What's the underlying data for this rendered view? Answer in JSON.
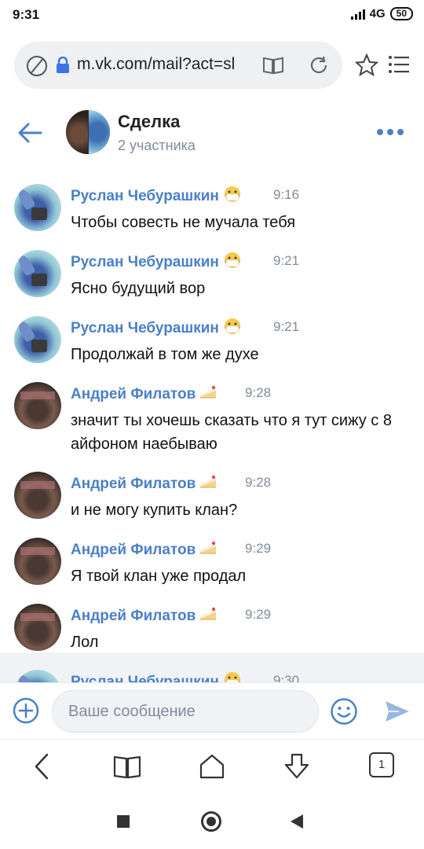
{
  "status_bar": {
    "time": "9:31",
    "network": "4G",
    "battery": "50"
  },
  "browser": {
    "url": "m.vk.com/mail?act=sl",
    "tab_count": "1"
  },
  "chat": {
    "title": "Сделка",
    "subtitle": "2 участника"
  },
  "messages": [
    {
      "author": "Руслан Чебурашкин",
      "emoji": "mask-emoji",
      "time": "9:16",
      "text": "Чтобы совесть не мучала тебя",
      "avatar": "stitch"
    },
    {
      "author": "Руслан Чебурашкин",
      "emoji": "mask-emoji",
      "time": "9:21",
      "text": "Ясно будущий вор",
      "avatar": "stitch"
    },
    {
      "author": "Руслан Чебурашкин",
      "emoji": "mask-emoji",
      "time": "9:21",
      "text": "Продолжай в том же духе",
      "avatar": "stitch"
    },
    {
      "author": "Андрей Филатов",
      "emoji": "cake-emoji",
      "time": "9:28",
      "text": "значит ты хочешь сказать что я тут сижу с 8 айфоном наебываю",
      "avatar": "andrey"
    },
    {
      "author": "Андрей Филатов",
      "emoji": "cake-emoji",
      "time": "9:28",
      "text": "и не могу купить клан?",
      "avatar": "andrey"
    },
    {
      "author": "Андрей Филатов",
      "emoji": "cake-emoji",
      "time": "9:29",
      "text": "Я твой клан уже продал",
      "avatar": "andrey"
    },
    {
      "author": "Андрей Филатов",
      "emoji": "cake-emoji",
      "time": "9:29",
      "text": "Лол",
      "avatar": "andrey"
    },
    {
      "author": "Руслан Чебурашкин",
      "emoji": "mask-emoji",
      "time": "9:30",
      "text": "",
      "avatar": "stitch"
    }
  ],
  "compose": {
    "placeholder": "Ваше сообщение"
  },
  "colors": {
    "accent": "#4a80c8",
    "secondary_text": "#818c99",
    "send_button": "#99b8e0"
  }
}
